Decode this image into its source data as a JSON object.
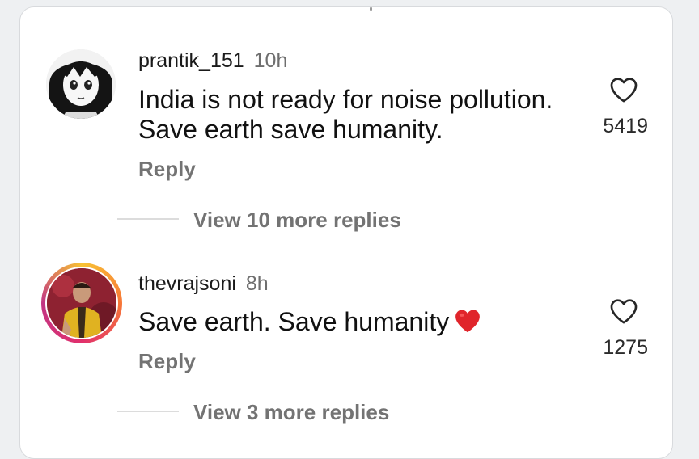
{
  "comments": [
    {
      "username": "prantik_151",
      "time": "10h",
      "text_lines": [
        "India is not ready for noise pollution.",
        "Save earth save humanity."
      ],
      "reply_label": "Reply",
      "like_count": "5419",
      "view_replies": "View 10 more replies",
      "has_story_ring": false
    },
    {
      "username": "thevrajsoni",
      "time": "8h",
      "text_lines": [
        "Save earth. Save humanity"
      ],
      "reply_label": "Reply",
      "like_count": "1275",
      "view_replies": "View 3 more replies",
      "has_story_ring": true
    }
  ],
  "icons": {
    "like": "heart-outline-icon",
    "emoji": "red-heart-emoji"
  },
  "colors": {
    "text": "#111111",
    "secondary": "#737373",
    "heart_emoji": "#e0252b"
  }
}
